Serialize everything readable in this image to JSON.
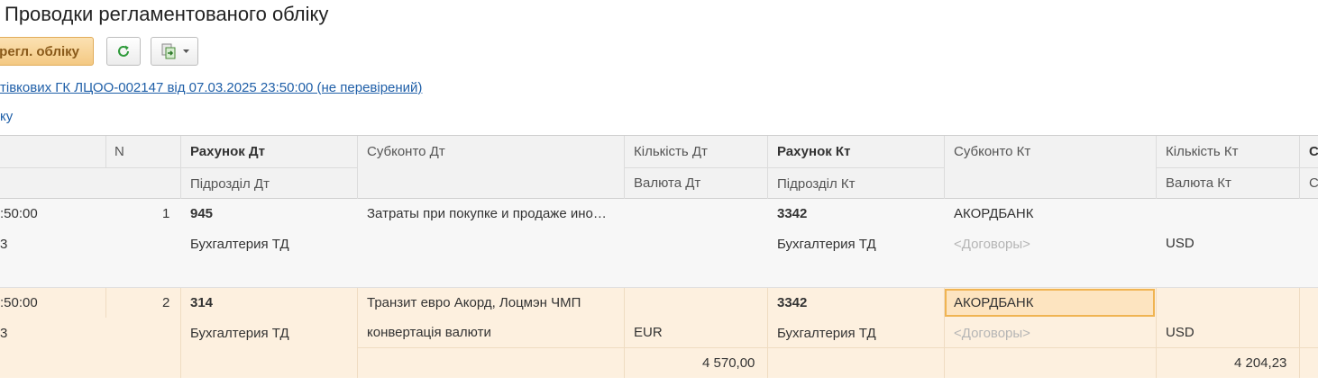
{
  "window": {
    "title": "Проводки регламентованого обліку"
  },
  "toolbar": {
    "primary_label": "регл. обліку",
    "refresh_icon": "refresh-icon",
    "export_icon": "export-icon"
  },
  "document_link": "тівкових ГК ЛЦОО-002147 від 07.03.2025 23:50:00 (не перевірений)",
  "secondary_link": "ку",
  "table": {
    "headers": {
      "n": "N",
      "account_dt": "Рахунок Дт",
      "subdivision_dt": "Підрозділ Дт",
      "subconto_dt": "Субконто Дт",
      "qty_dt": "Кількість Дт",
      "currency_dt": "Валюта Дт",
      "account_kt": "Рахунок Кт",
      "subdivision_kt": "Підрозділ Кт",
      "subconto_kt": "Субконто Кт",
      "qty_kt": "Кількість Кт",
      "currency_kt": "Валюта Кт",
      "cut_top": "С",
      "cut_bottom": "С"
    },
    "rows": [
      {
        "time": ":50:00",
        "time_sub": "3",
        "n": "1",
        "account_dt": "945",
        "subdivision_dt": "Бухгалтерия ТД",
        "subconto_dt_1": "Затраты при покупке и продаже ино…",
        "subconto_dt_2": "",
        "currency_dt": "",
        "amount_dt": "",
        "account_kt": "3342",
        "subdivision_kt": "Бухгалтерия ТД",
        "subconto_kt_1": "АКОРДБАНК",
        "subconto_kt_2": "<Договоры>",
        "currency_kt": "USD",
        "amount_kt": ""
      },
      {
        "time": ":50:00",
        "time_sub": "3",
        "n": "2",
        "account_dt": "314",
        "subdivision_dt": "Бухгалтерия ТД",
        "subconto_dt_1": "Транзит евро  Акорд, Лоцмэн ЧМП",
        "subconto_dt_2": "конвертація валюти",
        "currency_dt": "EUR",
        "amount_dt": "4 570,00",
        "account_kt": "3342",
        "subdivision_kt": "Бухгалтерия ТД",
        "subconto_kt_1": "АКОРДБАНК",
        "subconto_kt_2": "<Договоры>",
        "currency_kt": "USD",
        "amount_kt": "4 204,23"
      }
    ]
  }
}
